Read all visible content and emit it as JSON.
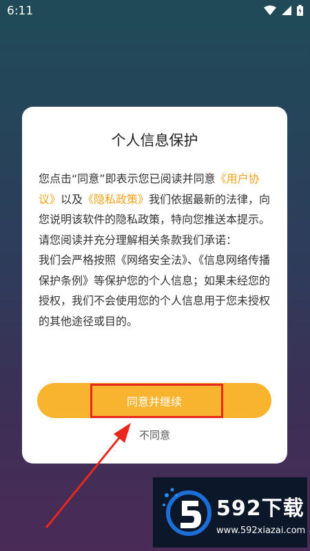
{
  "status_bar": {
    "time": "6:11"
  },
  "dialog": {
    "title": "个人信息保护",
    "body": {
      "part1": "您点击“同意”即表示您已阅读并同意",
      "user_agreement_link": "《用户协议》",
      "part2": "以及",
      "privacy_policy_link": "《隐私政策》",
      "part3": "我们依据最新的法律，向您说明该软件的隐私政策，特向您推送本提示。请您阅读并充分理解相关条款我们承诺：",
      "paragraph2": "我们会严格按照《网络安全法》、《信息网络传播保护条例》等保护您的个人信息；如果未经您的授权，我们不会使用您的个人信息用于您未授权的其他途径或目的。"
    },
    "agree_button_label": "同意并继续",
    "disagree_label": "不同意"
  },
  "watermark": {
    "name": "592下载",
    "url": "www.592xiazai.com"
  },
  "icons": {
    "wifi": "wifi-icon",
    "signal": "signal-icon",
    "battery": "battery-icon"
  },
  "colors": {
    "accent": "#f8b32f",
    "link": "#f2a21a",
    "annotation": "#e8281e"
  }
}
